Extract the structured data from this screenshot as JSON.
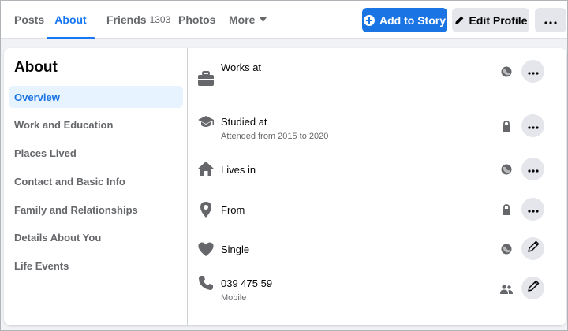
{
  "tabs": [
    {
      "label": "Posts"
    },
    {
      "label": "About"
    },
    {
      "label": "Friends",
      "count": "1303"
    },
    {
      "label": "Photos"
    },
    {
      "label": "More"
    }
  ],
  "actions": {
    "add_story": "Add to Story",
    "edit_profile": "Edit Profile"
  },
  "about": {
    "title": "About",
    "nav": [
      "Overview",
      "Work and Education",
      "Places Lived",
      "Contact and Basic Info",
      "Family and Relationships",
      "Details About You",
      "Life Events"
    ],
    "rows": [
      {
        "icon": "briefcase-icon",
        "main": "Works at",
        "privacy": "globe-icon",
        "action": "more-icon"
      },
      {
        "icon": "graduation-cap-icon",
        "main": "Studied at",
        "sub": "Attended from 2015 to 2020",
        "privacy": "lock-icon",
        "action": "more-icon"
      },
      {
        "icon": "home-icon",
        "main": "Lives in",
        "privacy": "globe-icon",
        "action": "more-icon"
      },
      {
        "icon": "location-pin-icon",
        "main": "From",
        "privacy": "lock-icon",
        "action": "more-icon"
      },
      {
        "icon": "heart-icon",
        "main": "Single",
        "privacy": "globe-icon",
        "action": "pencil-icon"
      },
      {
        "icon": "phone-icon",
        "main": "039 475 59",
        "sub": "Mobile",
        "privacy": "friends-icon",
        "action": "pencil-icon"
      }
    ]
  },
  "colors": {
    "accent": "#1877f2",
    "nav_active_bg": "#e7f3ff",
    "button_grey": "#e4e6eb",
    "icon_grey": "#65676b"
  }
}
